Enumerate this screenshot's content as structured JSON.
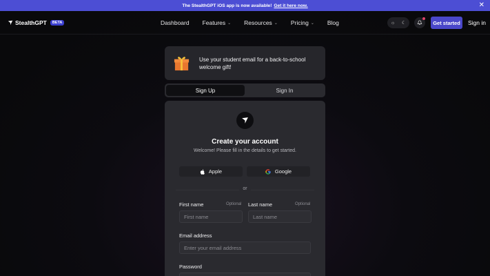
{
  "banner": {
    "text": "The StealthGPT iOS app is now available!",
    "link": "Get it here now.",
    "close_icon": "close-icon"
  },
  "nav": {
    "brand": "StealthGPT",
    "badge": "BETA",
    "links": [
      {
        "label": "Dashboard",
        "has_dropdown": false
      },
      {
        "label": "Features",
        "has_dropdown": true
      },
      {
        "label": "Resources",
        "has_dropdown": true
      },
      {
        "label": "Pricing",
        "has_dropdown": true
      },
      {
        "label": "Blog",
        "has_dropdown": false
      }
    ],
    "get_started": "Get started",
    "sign_in": "Sign in"
  },
  "promo": {
    "text": "Use your student email for a back-to-school welcome gift!"
  },
  "tabs": {
    "sign_up": "Sign Up",
    "sign_in": "Sign In",
    "active": "sign_up"
  },
  "form": {
    "title": "Create your account",
    "subtitle": "Welcome! Please fill in the details to get started.",
    "apple": "Apple",
    "google": "Google",
    "or": "or",
    "first_name": {
      "label": "First name",
      "optional": "Optional",
      "placeholder": "First name",
      "value": ""
    },
    "last_name": {
      "label": "Last name",
      "optional": "Optional",
      "placeholder": "Last name",
      "value": ""
    },
    "email": {
      "label": "Email address",
      "placeholder": "Enter your email address",
      "value": ""
    },
    "password": {
      "label": "Password",
      "value": ""
    }
  },
  "colors": {
    "accent": "#4a47c9",
    "banner": "#4c4ed4",
    "card": "#2a2a2f",
    "background": "#09090b"
  }
}
